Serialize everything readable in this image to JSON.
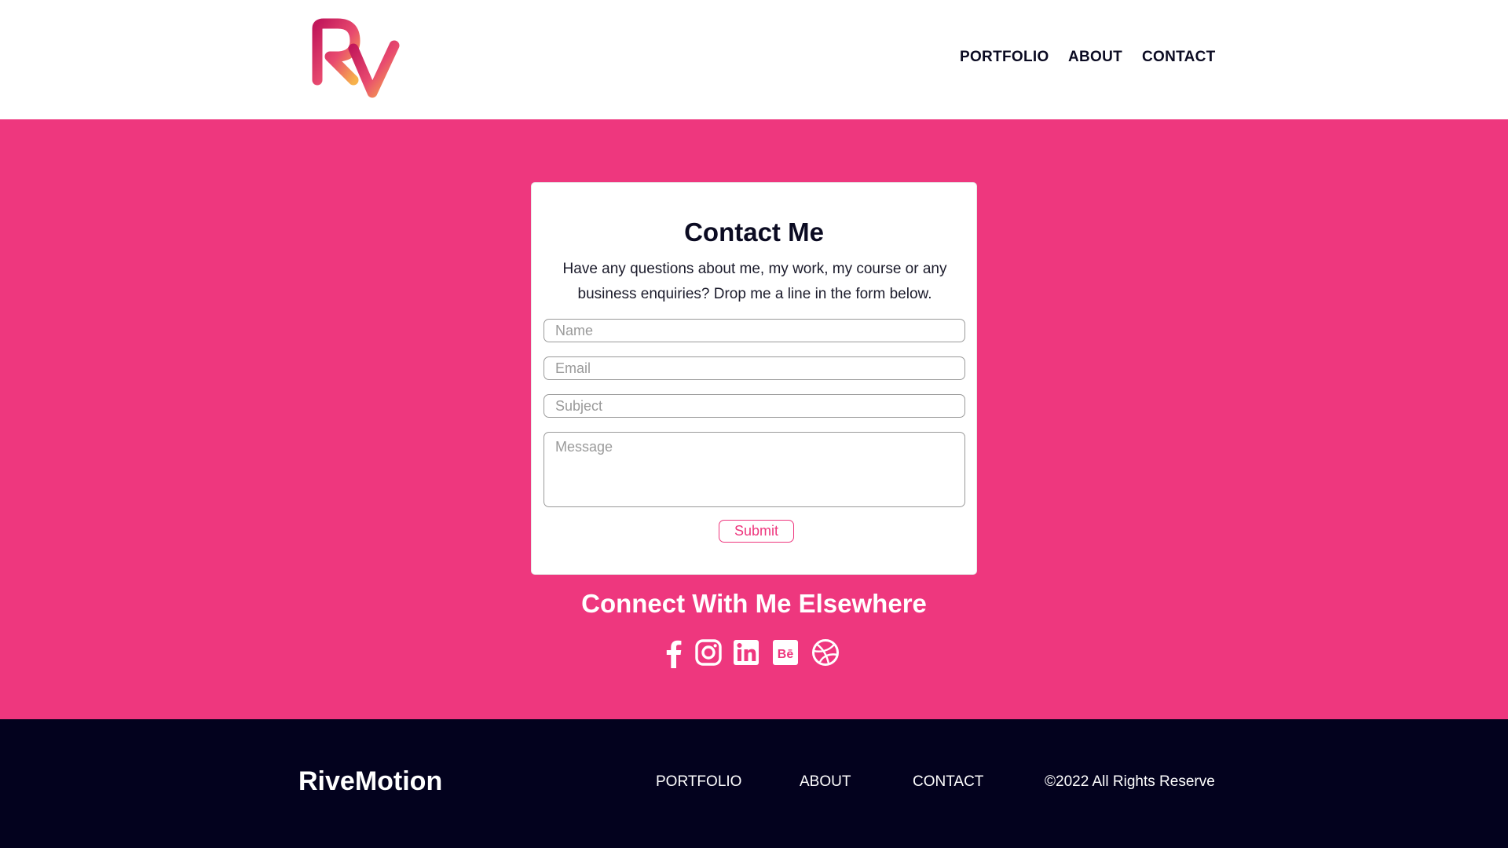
{
  "header": {
    "logo_text": "Rv",
    "nav": [
      {
        "label": "PORTFOLIO"
      },
      {
        "label": "ABOUT"
      },
      {
        "label": "CONTACT"
      }
    ]
  },
  "contact": {
    "title": "Contact Me",
    "description": "Have any questions about me, my work, my course or any business enquiries? Drop me a line in the form below.",
    "fields": {
      "name_placeholder": "Name",
      "email_placeholder": "Email",
      "subject_placeholder": "Subject",
      "message_placeholder": "Message"
    },
    "submit_label": "Submit"
  },
  "connect": {
    "title": "Connect With Me Elsewhere",
    "icons": [
      "facebook-icon",
      "instagram-icon",
      "linkedin-icon",
      "behance-icon",
      "dribbble-icon"
    ]
  },
  "footer": {
    "brand": "RiveMotion",
    "links": [
      {
        "label": "PORTFOLIO"
      },
      {
        "label": "ABOUT"
      },
      {
        "label": "CONTACT"
      }
    ],
    "copyright": "©2022 All Rights Reserve"
  },
  "colors": {
    "accent": "#ee377e",
    "dark": "#03021e",
    "white": "#ffffff"
  }
}
